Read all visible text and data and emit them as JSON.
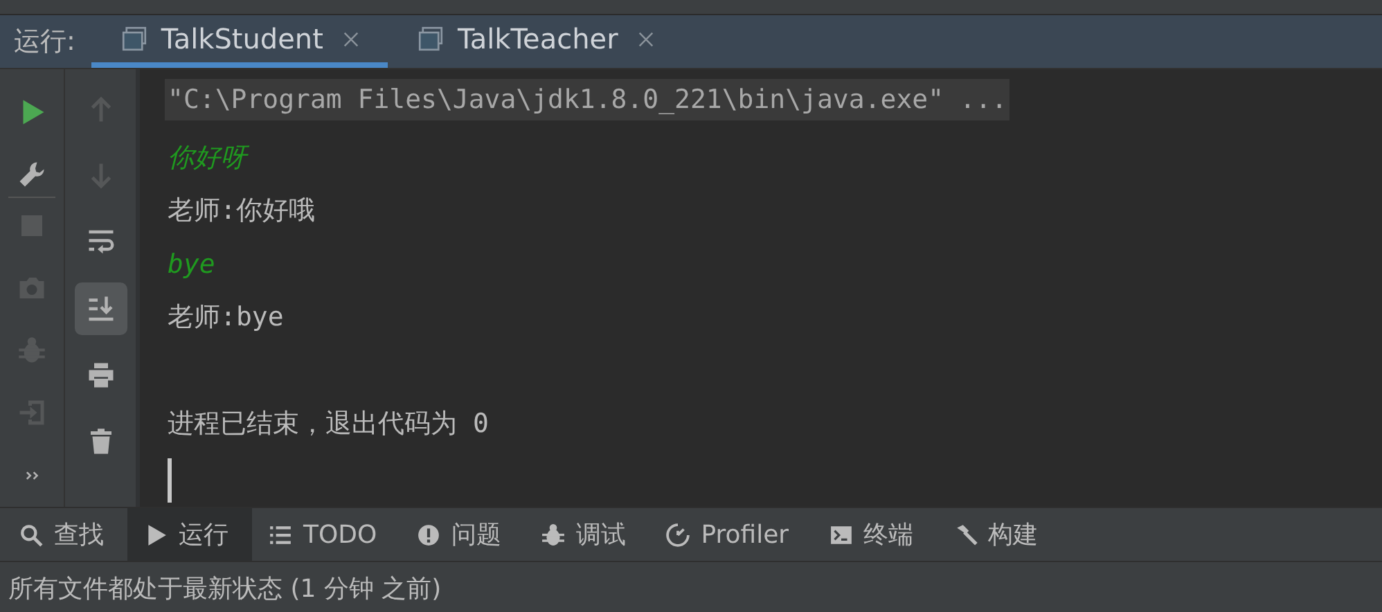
{
  "run_panel": {
    "label": "运行:",
    "tabs": [
      {
        "label": "TalkStudent",
        "selected": true
      },
      {
        "label": "TalkTeacher",
        "selected": false
      }
    ]
  },
  "side_toolbar": [
    {
      "kind": "run",
      "disabled": false
    },
    {
      "kind": "wrench",
      "disabled": false
    },
    {
      "kind": "separator"
    },
    {
      "kind": "stop",
      "disabled": true
    },
    {
      "kind": "camera",
      "disabled": true
    },
    {
      "kind": "bug",
      "disabled": true
    },
    {
      "kind": "exit",
      "disabled": true
    },
    {
      "kind": "more",
      "disabled": false
    }
  ],
  "console_toolbar": [
    {
      "kind": "up",
      "disabled": true,
      "selected": false
    },
    {
      "kind": "down",
      "disabled": true,
      "selected": false
    },
    {
      "kind": "wrap",
      "disabled": false,
      "selected": false
    },
    {
      "kind": "scroll-end",
      "disabled": false,
      "selected": true
    },
    {
      "kind": "print",
      "disabled": false,
      "selected": false
    },
    {
      "kind": "trash",
      "disabled": false,
      "selected": false
    }
  ],
  "console": [
    {
      "kind": "command",
      "text": "\"C:\\Program Files\\Java\\jdk1.8.0_221\\bin\\java.exe\" ..."
    },
    {
      "kind": "input",
      "text": "你好呀"
    },
    {
      "kind": "output",
      "text": "老师:你好哦"
    },
    {
      "kind": "input",
      "text": "bye"
    },
    {
      "kind": "output",
      "text": "老师:bye"
    },
    {
      "kind": "blank"
    },
    {
      "kind": "output",
      "text": "进程已结束，退出代码为 0"
    },
    {
      "kind": "cursor"
    }
  ],
  "tool_windows": [
    {
      "kind": "search",
      "label": "查找",
      "selected": false
    },
    {
      "kind": "run",
      "label": "运行",
      "selected": true
    },
    {
      "kind": "list",
      "label": "TODO",
      "selected": false
    },
    {
      "kind": "problem",
      "label": "问题",
      "selected": false
    },
    {
      "kind": "bug",
      "label": "调试",
      "selected": false
    },
    {
      "kind": "profiler",
      "label": "Profiler",
      "selected": false
    },
    {
      "kind": "terminal",
      "label": "终端",
      "selected": false
    },
    {
      "kind": "hammer",
      "label": "构建",
      "selected": false
    }
  ],
  "status_bar": "所有文件都处于最新状态 (1 分钟 之前)"
}
